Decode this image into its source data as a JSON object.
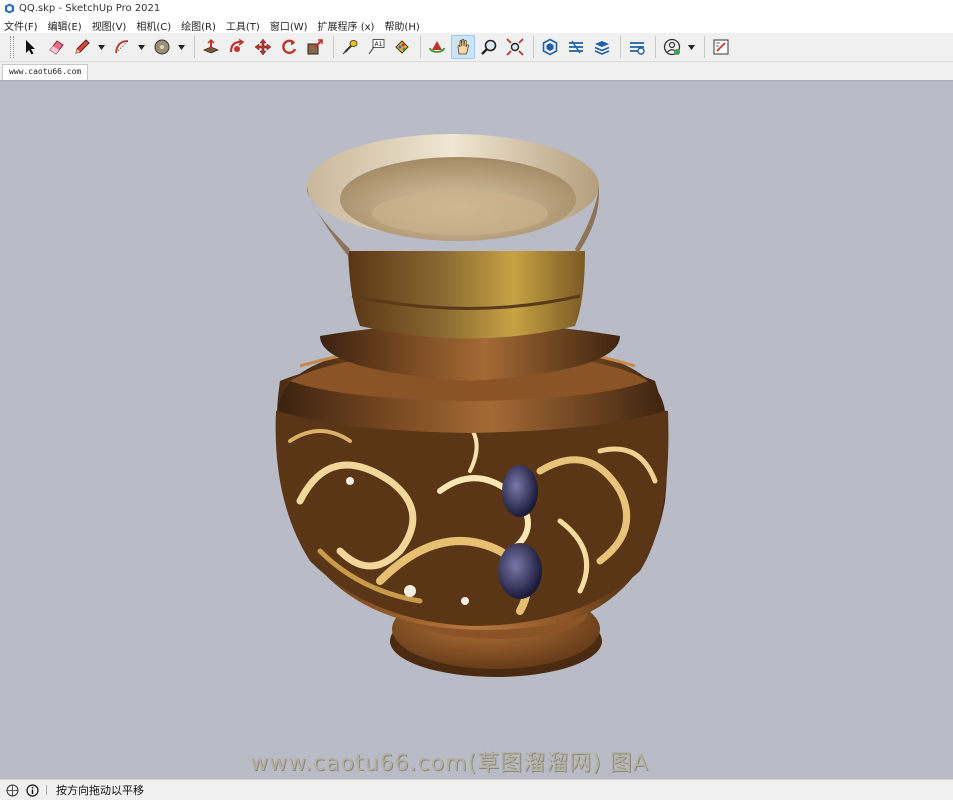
{
  "window": {
    "title": "QQ.skp - SketchUp Pro 2021"
  },
  "menu": [
    "文件(F)",
    "编辑(E)",
    "视图(V)",
    "相机(C)",
    "绘图(R)",
    "工具(T)",
    "窗口(W)",
    "扩展程序 (x)",
    "帮助(H)"
  ],
  "toolbar": {
    "active_tool": "pan-icon",
    "tools": [
      "select-arrow-icon",
      "eraser-icon",
      "pencil-line-icon",
      "arc-icon",
      "shape-circle-icon",
      "push-pull-icon",
      "follow-me-icon",
      "move-icon",
      "rotate-icon",
      "scale-icon",
      "tape-measure-icon",
      "text-label-icon",
      "paint-bucket-icon",
      "orbit-icon",
      "pan-icon",
      "zoom-icon",
      "zoom-extents-icon",
      "3d-warehouse-icon",
      "extension-warehouse-icon",
      "layout-icon",
      "extension-manager-icon",
      "profile-icon",
      "style-edit-icon"
    ]
  },
  "scene_tab": {
    "label": "www.caotu66.com"
  },
  "viewport": {
    "watermark": "www.caotu66.com(草图溜溜网) 图A",
    "background_color": "#b9bcc6"
  },
  "status": {
    "message": "按方向拖动以平移"
  }
}
